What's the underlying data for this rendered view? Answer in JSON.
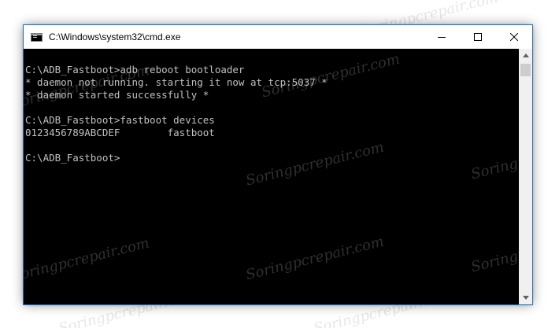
{
  "window": {
    "title": "C:\\Windows\\system32\\cmd.exe",
    "minimize_icon": "minimize-icon",
    "maximize_icon": "maximize-icon",
    "close_icon": "close-icon"
  },
  "terminal": {
    "lines": [
      "C:\\ADB_Fastboot>adb reboot bootloader",
      "* daemon not running. starting it now at tcp:5037 *",
      "* daemon started successfully *",
      "",
      "C:\\ADB_Fastboot>fastboot devices",
      "0123456789ABCDEF        fastboot",
      "",
      "C:\\ADB_Fastboot>"
    ]
  },
  "watermark": "Soringpcrepair.com",
  "colors": {
    "terminal_bg": "#000000",
    "terminal_text": "#c0c0c0",
    "titlebar_bg": "#ffffff",
    "border": "#2b6fb3"
  }
}
